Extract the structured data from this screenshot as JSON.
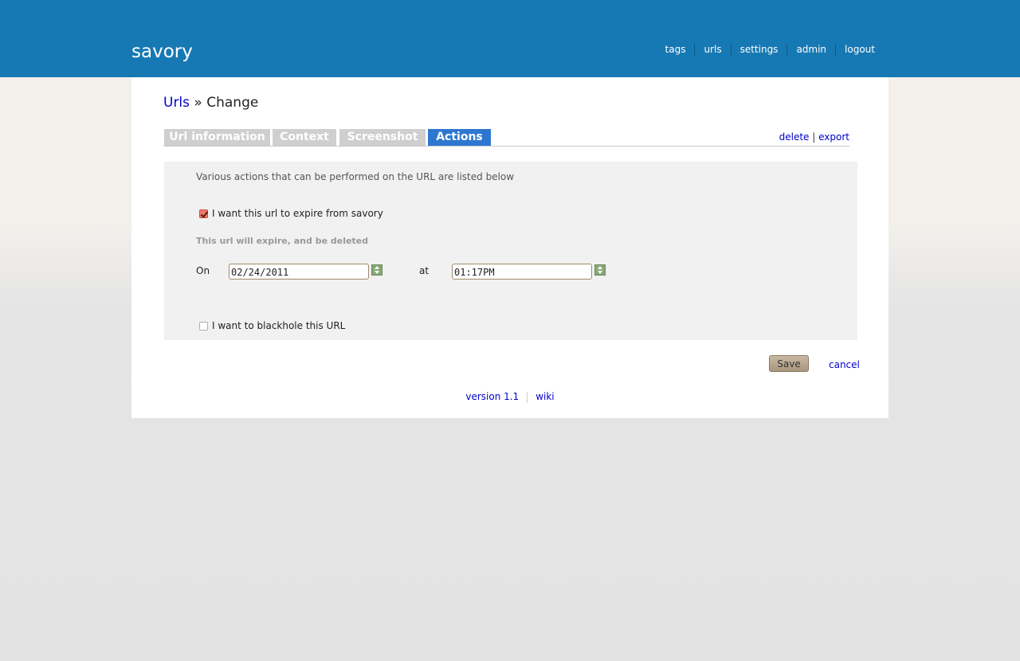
{
  "app": {
    "logo": "savory"
  },
  "topnav": [
    "tags",
    "urls",
    "settings",
    "admin",
    "logout"
  ],
  "breadcrumb": {
    "link": "Urls",
    "separator": "»",
    "current": "Change"
  },
  "tabs": [
    "Url information",
    "Context",
    "Screenshot",
    "Actions"
  ],
  "active_tab": "Actions",
  "tab_links": {
    "delete": "delete",
    "separator": "|",
    "export": "export"
  },
  "panel": {
    "description": "Various actions that can be performed on the URL are listed below",
    "expire_label": "I want this url to expire from savory",
    "expire_checked": true,
    "expire_note": "This url will expire, and be deleted",
    "on_label": "On",
    "date_value": "02/24/2011",
    "at_label": "at",
    "time_value": "01:17PM",
    "blackhole_label": "I want to blackhole this URL",
    "blackhole_checked": false
  },
  "actions": {
    "save": "Save",
    "cancel": "cancel"
  },
  "footer": {
    "version": "version 1.1",
    "wiki": "wiki"
  },
  "colors": {
    "header": "#1779b3",
    "active_tab": "#2e77d0",
    "link": "#0000cc"
  }
}
